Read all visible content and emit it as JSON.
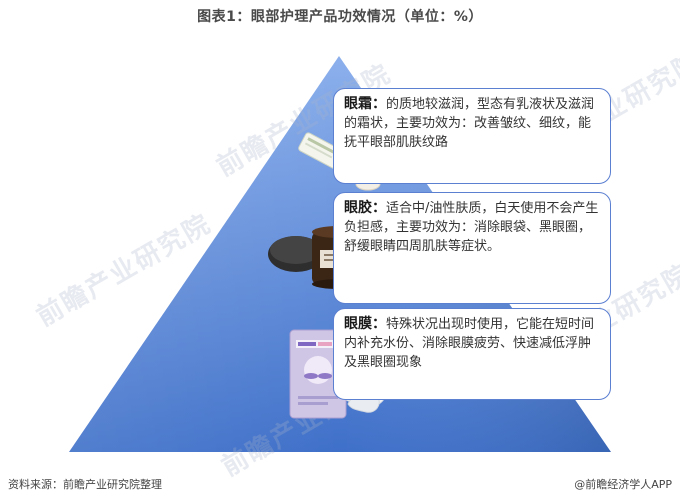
{
  "title": "图表1：眼部护理产品功效情况（单位：%）",
  "tiers": [
    {
      "label": "眼霜：",
      "text": "的质地较滋润，型态有乳液状及滋润的霜状，主要功效为：改善皱纹、细纹，能抚平眼部肌肤纹路"
    },
    {
      "label": "眼胶：",
      "text": "适合中/油性肤质，白天使用不会产生负担感，主要功效为：消除眼袋、黑眼圈，舒缓眼睛四周肌肤等症状。"
    },
    {
      "label": "眼膜：",
      "text": "特殊状况出现时使用，它能在短时间内补充水份、消除眼膜疲劳、快速减低浮肿及黑眼圈现象"
    }
  ],
  "watermark": "前瞻产业研究院",
  "footer": {
    "source": "资料来源：前瞻产业研究院整理",
    "brand": "@前瞻经济学人APP"
  },
  "colors": {
    "pyramid_top": "#7fa6e8",
    "pyramid_bottom": "#3d6fc9",
    "callout_border": "#5b7fd1"
  }
}
